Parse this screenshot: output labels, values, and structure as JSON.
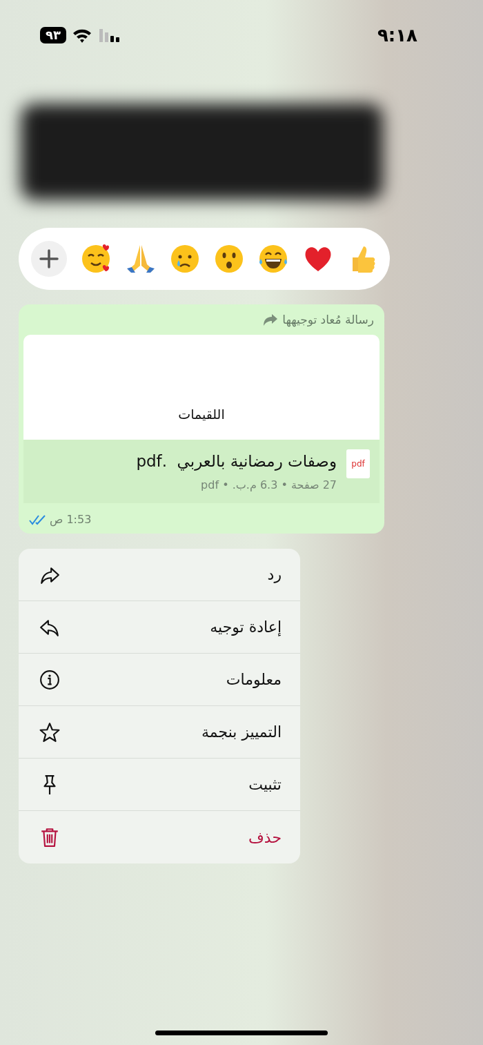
{
  "status_bar": {
    "time": "٩:١٨",
    "battery": "٩٣"
  },
  "message": {
    "forwarded_label": "رسالة مُعاد توجيهها",
    "preview_title": "اللقيمات",
    "file_icon_label": "pdf",
    "file_name": "وصفات رمضانية بالعربي  .pdf",
    "file_meta": "27 صفحة • 6.3 م.ب. • pdf",
    "time": "1:53 ص",
    "read": true
  },
  "menu": [
    {
      "label": "رد",
      "kind": "reply",
      "destructive": false
    },
    {
      "label": "إعادة توجيه",
      "kind": "forward",
      "destructive": false
    },
    {
      "label": "معلومات",
      "kind": "info",
      "destructive": false
    },
    {
      "label": "التمييز بنجمة",
      "kind": "star",
      "destructive": false
    },
    {
      "label": "تثبيت",
      "kind": "pin",
      "destructive": false
    },
    {
      "label": "حذف",
      "kind": "delete",
      "destructive": true
    }
  ]
}
